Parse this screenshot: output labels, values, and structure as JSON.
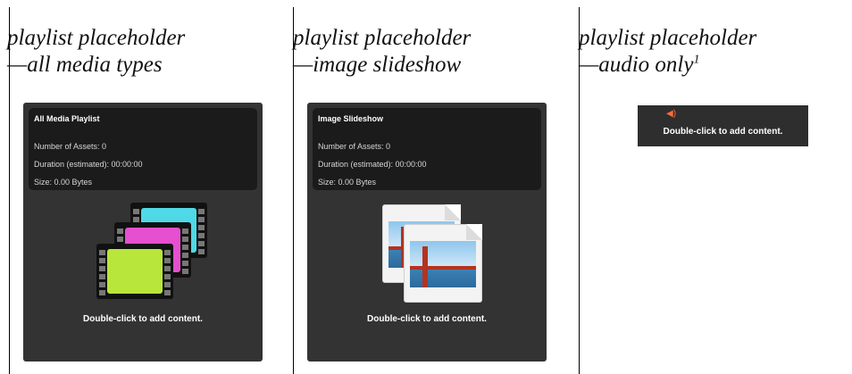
{
  "columns": [
    {
      "heading_line1": "playlist placeholder",
      "heading_line2": "—all media types",
      "panel": {
        "title": "All Media Playlist",
        "assets": "Number of Assets: 0",
        "duration": "Duration (estimated): 00:00:00",
        "size": "Size: 0.00 Bytes",
        "cta": "Double-click to add content."
      },
      "icon": "film-reels-icon"
    },
    {
      "heading_line1": "playlist placeholder",
      "heading_line2": "—image slideshow",
      "panel": {
        "title": "Image Slideshow",
        "assets": "Number of Assets: 0",
        "duration": "Duration (estimated): 00:00:00",
        "size": "Size: 0.00 Bytes",
        "cta": "Double-click to add content."
      },
      "icon": "photo-slides-icon"
    },
    {
      "heading_line1": "playlist placeholder",
      "heading_line2": "—audio only",
      "heading_sup": "1",
      "panel": {
        "cta": "Double-click to add content."
      },
      "icon": "speaker-icon"
    }
  ],
  "colors": {
    "panel_bg": "#333333",
    "info_bg": "#1b1b1b",
    "film_cyan": "#4fd9e6",
    "film_magenta": "#e64fd0",
    "film_lime": "#b8e63a"
  }
}
